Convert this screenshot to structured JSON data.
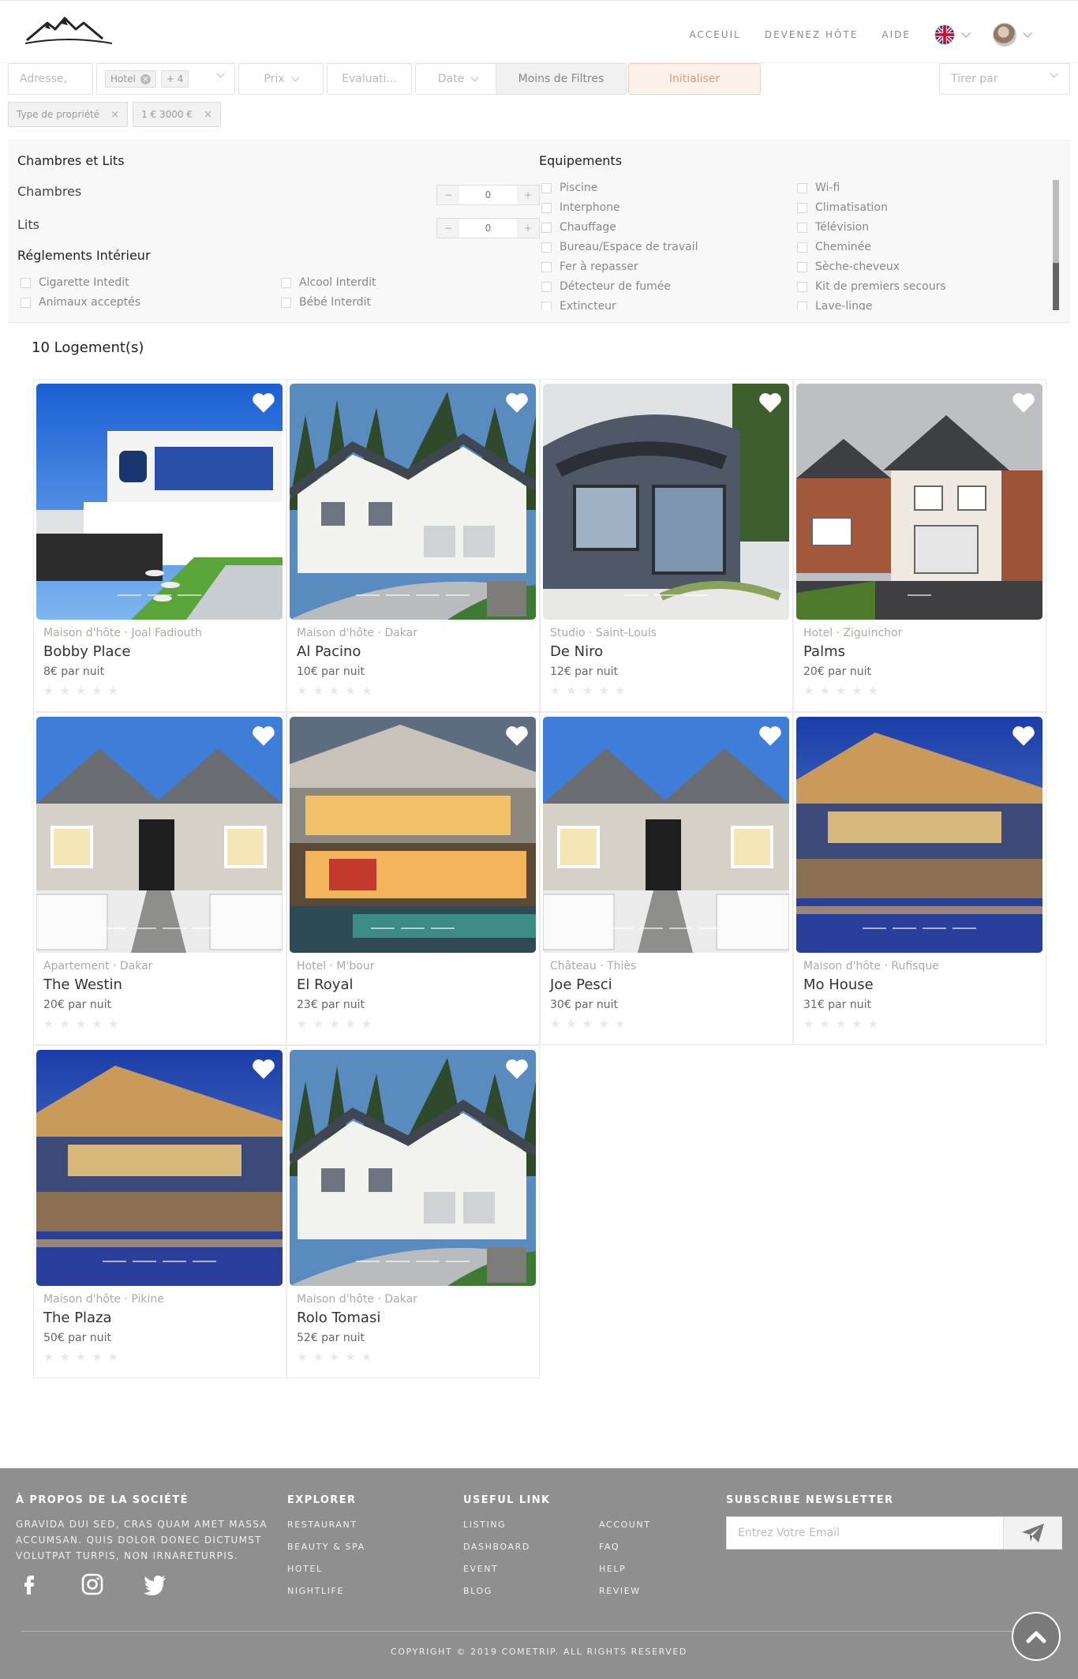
{
  "header": {
    "nav": [
      "ACCEUIL",
      "DEVENEZ HÔTE",
      "AIDE"
    ]
  },
  "filters": {
    "address_placeholder": "Adresse,",
    "type_tag": "Hotel",
    "type_more": "+ 4",
    "price": "Prix",
    "rating": "Evaluati...",
    "date": "Date",
    "less_filters": "Moins de Filtres",
    "reset": "Initialiser",
    "sort": "Tirer par",
    "chips": [
      "Type de propriété",
      "1 € 3000 €"
    ]
  },
  "panel": {
    "rooms_title": "Chambres et Lits",
    "rooms_label": "Chambres",
    "rooms_value": "0",
    "beds_label": "Lits",
    "beds_value": "0",
    "rules_title": "Réglements Intérieur",
    "rules": [
      "Cigarette Intedit",
      "Alcool Interdit",
      "Animaux acceptés",
      "Bébé Interdit"
    ],
    "equip_title": "Equipements",
    "equip_left": [
      "Piscine",
      "Interphone",
      "Chauffage",
      "Bureau/Espace de travail",
      "Fer à repasser",
      "Détecteur de fumée",
      "Extincteur"
    ],
    "equip_right": [
      "Wi-fi",
      "Climatisation",
      "Télévision",
      "Cheminée",
      "Sèche-cheveux",
      "Kit de premiers secours",
      "Lave-linge"
    ]
  },
  "listing_count": "10 Logement(s)",
  "listings": [
    {
      "meta": "Maison d'hôte · Joal Fadiouth",
      "title": "Bobby Place",
      "price": "8€ par nuit"
    },
    {
      "meta": "Maison d'hôte · Dakar",
      "title": "Al Pacino",
      "price": "10€ par nuit"
    },
    {
      "meta": "Studio · Saint-Louis",
      "title": "De Niro",
      "price": "12€ par nuit"
    },
    {
      "meta": "Hotel · Ziguinchor",
      "title": "Palms",
      "price": "20€ par nuit"
    },
    {
      "meta": "Apartement · Dakar",
      "title": "The Westin",
      "price": "20€ par nuit"
    },
    {
      "meta": "Hotel · M'bour",
      "title": "El Royal",
      "price": "23€ par nuit"
    },
    {
      "meta": "Château · Thiès",
      "title": "Joe Pesci",
      "price": "30€ par nuit"
    },
    {
      "meta": "Maison d'hôte · Rufisque",
      "title": "Mo House",
      "price": "31€ par nuit"
    },
    {
      "meta": "Maison d'hôte · Pikine",
      "title": "The Plaza",
      "price": "50€ par nuit"
    },
    {
      "meta": "Maison d'hôte · Dakar",
      "title": "Rolo Tomasi",
      "price": "52€ par nuit"
    }
  ],
  "stars": "★★★★★",
  "footer": {
    "about_title": "À PROPOS DE LA SOCIÉTÉ",
    "about_text": "Gravida dui sed, cras quam amet massa accumsan. Quis dolor donec dictumst volutpat turpis, non irnareturpis.",
    "explorer_title": "EXPLORER",
    "explorer": [
      "Restaurant",
      "Beauty & Spa",
      "Hotel",
      "Nightlife"
    ],
    "useful_title": "USEFUL LINK",
    "useful_col1": [
      "Listing",
      "Dashboard",
      "Event",
      "Blog"
    ],
    "useful_col2": [
      "Account",
      "FAQ",
      "Help",
      "Review"
    ],
    "newsletter_title": "SUBSCRIBE NEWSLETTER",
    "newsletter_placeholder": "Entrez Votre Email",
    "copyright": "COPYRIGHT © 2019 COMETRIP. ALL RIGHTS RESERVED"
  }
}
